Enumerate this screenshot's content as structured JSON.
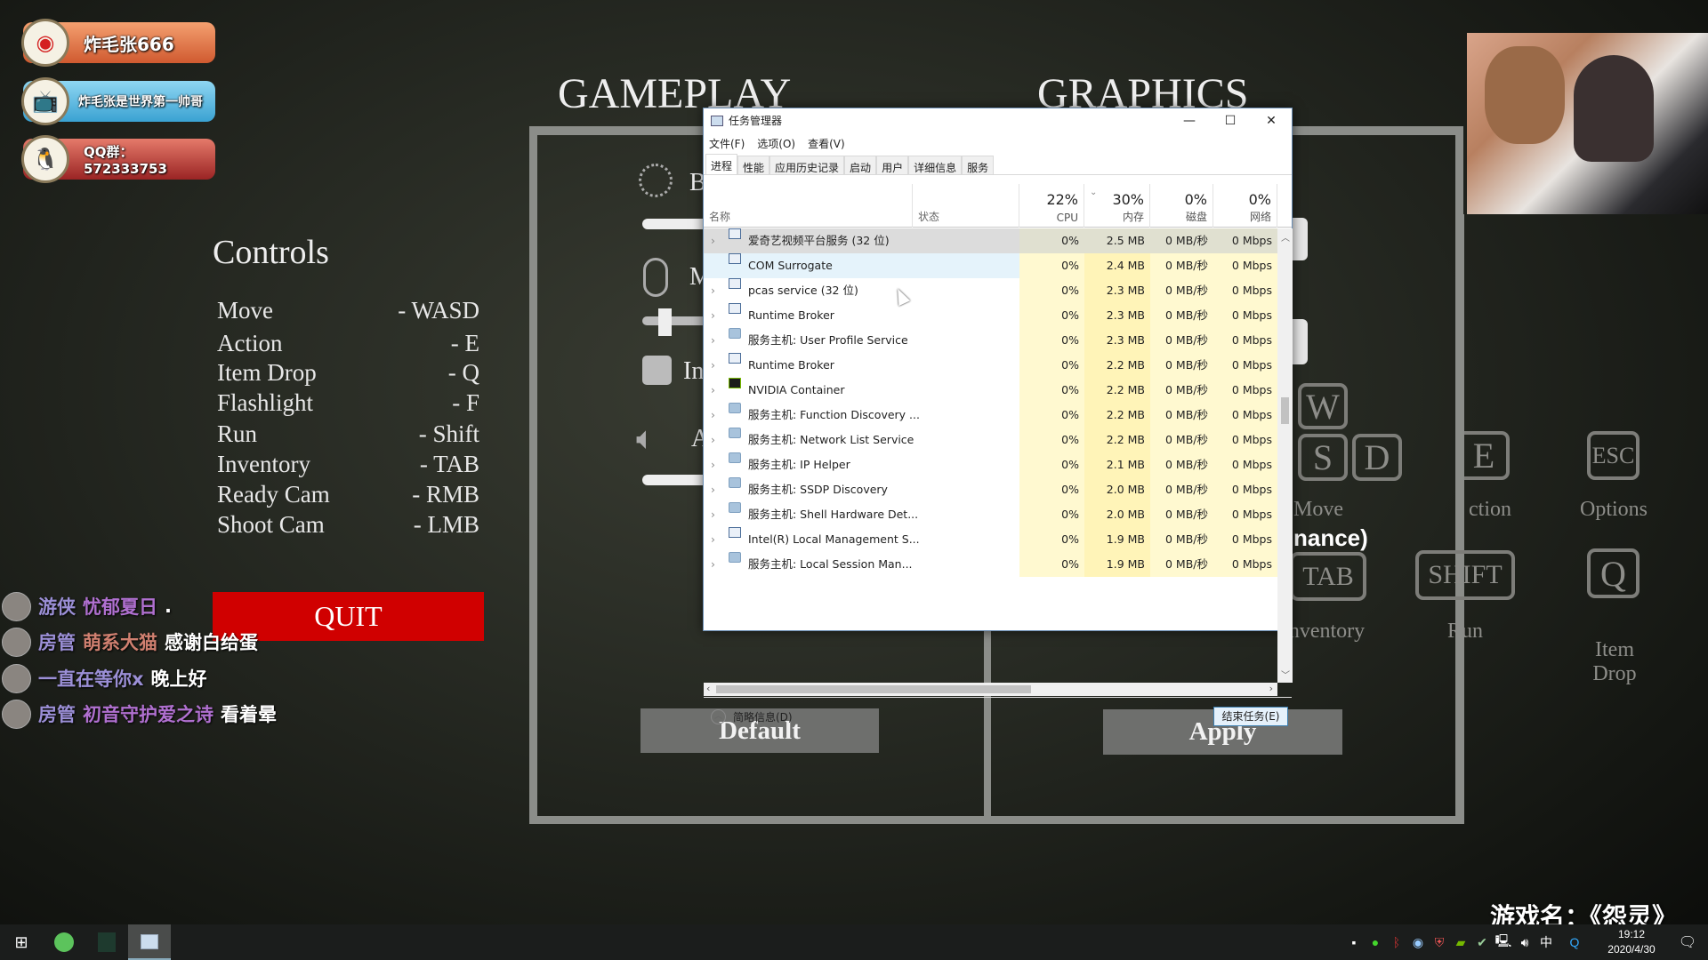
{
  "stream_badges": [
    {
      "icon": "weibo-icon",
      "text": "炸毛张666",
      "color": "#e0703a"
    },
    {
      "icon": "bilibili-icon",
      "text": "炸毛张是世界第一帅哥",
      "color": "#4ab3e0"
    },
    {
      "icon": "qq-icon",
      "text": "QQ群：572333753",
      "color": "#c0403a"
    }
  ],
  "game": {
    "gameplay_title": "GAMEPLAY",
    "graphics_title": "GRAPHICS",
    "controls_title": "Controls",
    "controls": [
      {
        "action": "Move",
        "key": "- WASD"
      },
      {
        "action": "Action",
        "key": "- E"
      },
      {
        "action": "Item Drop",
        "key": "- Q"
      },
      {
        "action": "Flashlight",
        "key": "- F"
      },
      {
        "action": "Run",
        "key": "- Shift"
      },
      {
        "action": "Inventory",
        "key": "- TAB"
      },
      {
        "action": "Ready Cam",
        "key": "- RMB"
      },
      {
        "action": "Shoot Cam",
        "key": "- LMB"
      }
    ],
    "quit_label": "QUIT",
    "settings_partial": {
      "brightness": "B",
      "mouse": "M",
      "invert": "In",
      "audio": "A"
    },
    "default_label": "Default",
    "apply_label": "Apply",
    "keys": {
      "w": "W",
      "s": "S",
      "d": "D",
      "e": "E",
      "esc": "ESC",
      "tab": "TAB",
      "shift": "SHIFT",
      "q": "Q"
    },
    "key_labels": {
      "move": "Move",
      "action": "ction",
      "options": "Options",
      "inventory": "Inventory",
      "run": "Run",
      "item_drop_1": "Item",
      "item_drop_2": "Drop"
    },
    "overlay_text": "nance)",
    "accent_quit": "#d00000"
  },
  "chat": [
    {
      "role": "游侠",
      "user": "忧郁夏日",
      "msg": ".",
      "user_color": "#b070d0"
    },
    {
      "role": "房管",
      "user": "萌系大猫",
      "msg": "感谢白给蛋",
      "user_color": "#d08070"
    },
    {
      "role": "",
      "user": "一直在等你x",
      "msg": "晚上好",
      "user_color": "#9b8fd6"
    },
    {
      "role": "房管",
      "user": "初音守护爱之诗",
      "msg": "看着晕",
      "user_color": "#b070d0"
    }
  ],
  "game_name": "游戏名：《怨灵》",
  "task_manager": {
    "title": "任务管理器",
    "menu": [
      "文件(F)",
      "选项(O)",
      "查看(V)"
    ],
    "tabs": [
      "进程",
      "性能",
      "应用历史记录",
      "启动",
      "用户",
      "详细信息",
      "服务"
    ],
    "active_tab": "进程",
    "columns": {
      "name": "名称",
      "status": "状态",
      "cpu": {
        "pct": "22%",
        "label": "CPU"
      },
      "mem": {
        "pct": "30%",
        "label": "内存"
      },
      "disk": {
        "pct": "0%",
        "label": "磁盘"
      },
      "net": {
        "pct": "0%",
        "label": "网络"
      }
    },
    "processes": [
      {
        "name": "爱奇艺视频平台服务 (32 位)",
        "icon": "app",
        "cpu": "0%",
        "mem": "2.5 MB",
        "disk": "0 MB/秒",
        "net": "0 Mbps",
        "state": "selected",
        "expand": true
      },
      {
        "name": "COM Surrogate",
        "icon": "app",
        "cpu": "0%",
        "mem": "2.4 MB",
        "disk": "0 MB/秒",
        "net": "0 Mbps",
        "state": "hover",
        "expand": false
      },
      {
        "name": "pcas service (32 位)",
        "icon": "app",
        "cpu": "0%",
        "mem": "2.3 MB",
        "disk": "0 MB/秒",
        "net": "0 Mbps",
        "expand": true
      },
      {
        "name": "Runtime Broker",
        "icon": "app",
        "cpu": "0%",
        "mem": "2.3 MB",
        "disk": "0 MB/秒",
        "net": "0 Mbps",
        "expand": true
      },
      {
        "name": "服务主机: User Profile Service",
        "icon": "gear",
        "cpu": "0%",
        "mem": "2.3 MB",
        "disk": "0 MB/秒",
        "net": "0 Mbps",
        "expand": true
      },
      {
        "name": "Runtime Broker",
        "icon": "app",
        "cpu": "0%",
        "mem": "2.2 MB",
        "disk": "0 MB/秒",
        "net": "0 Mbps",
        "expand": true
      },
      {
        "name": "NVIDIA Container",
        "icon": "nv",
        "cpu": "0%",
        "mem": "2.2 MB",
        "disk": "0 MB/秒",
        "net": "0 Mbps",
        "expand": true
      },
      {
        "name": "服务主机: Function Discovery ...",
        "icon": "gear",
        "cpu": "0%",
        "mem": "2.2 MB",
        "disk": "0 MB/秒",
        "net": "0 Mbps",
        "expand": true
      },
      {
        "name": "服务主机: Network List Service",
        "icon": "gear",
        "cpu": "0%",
        "mem": "2.2 MB",
        "disk": "0 MB/秒",
        "net": "0 Mbps",
        "expand": true
      },
      {
        "name": "服务主机: IP Helper",
        "icon": "gear",
        "cpu": "0%",
        "mem": "2.1 MB",
        "disk": "0 MB/秒",
        "net": "0 Mbps",
        "expand": true
      },
      {
        "name": "服务主机: SSDP Discovery",
        "icon": "gear",
        "cpu": "0%",
        "mem": "2.0 MB",
        "disk": "0 MB/秒",
        "net": "0 Mbps",
        "expand": true
      },
      {
        "name": "服务主机: Shell Hardware Det...",
        "icon": "gear",
        "cpu": "0%",
        "mem": "2.0 MB",
        "disk": "0 MB/秒",
        "net": "0 Mbps",
        "expand": true
      },
      {
        "name": "Intel(R) Local Management S...",
        "icon": "app",
        "cpu": "0%",
        "mem": "1.9 MB",
        "disk": "0 MB/秒",
        "net": "0 Mbps",
        "expand": true
      },
      {
        "name": "服务主机: Local Session Man...",
        "icon": "gear",
        "cpu": "0%",
        "mem": "1.9 MB",
        "disk": "0 MB/秒",
        "net": "0 Mbps",
        "expand": true
      }
    ],
    "fewer_details": "简略信息(D)",
    "end_task": "结束任务(E)"
  },
  "taskbar": {
    "tray_icons": [
      "monitor-icon",
      "razer-icon",
      "bluetooth-icon",
      "steam-icon",
      "security-icon",
      "nvidia-icon",
      "network-drive-icon",
      "network-icon",
      "volume-icon"
    ],
    "ime": "中",
    "time": "19:12",
    "date": "2020/4/30"
  }
}
